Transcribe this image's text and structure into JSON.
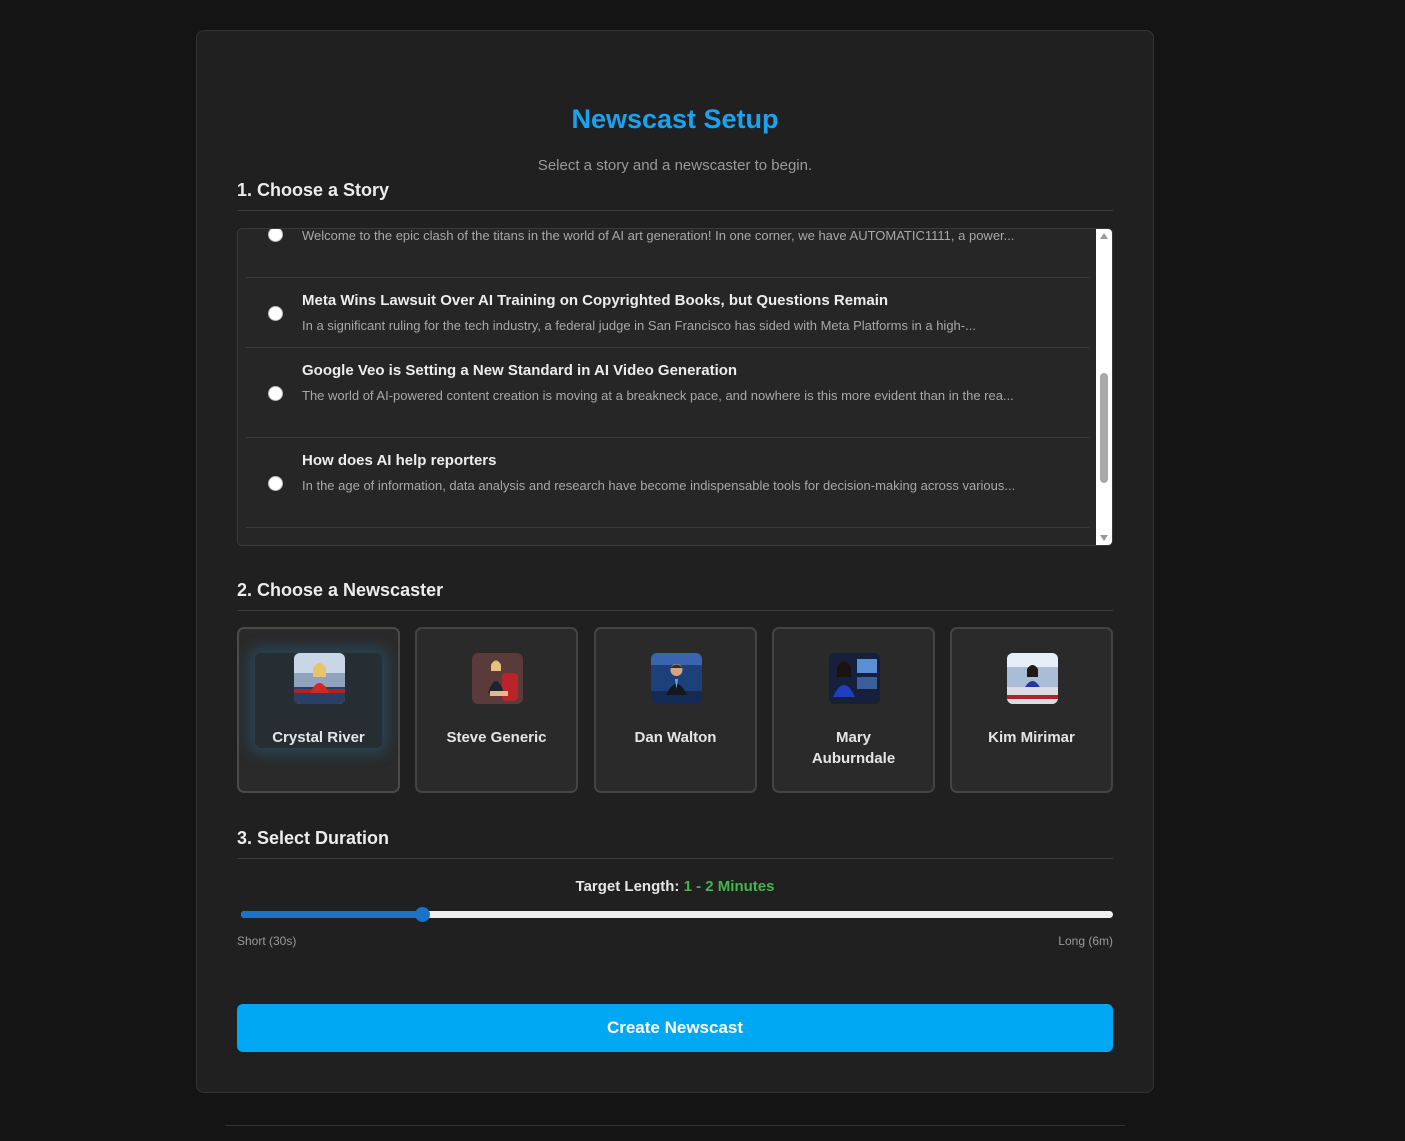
{
  "header": {
    "title": "Newscast Setup",
    "subtitle": "Select a story and a newscaster to begin."
  },
  "sections": {
    "story": "1. Choose a Story",
    "newscaster": "2. Choose a Newscaster",
    "duration": "3. Select Duration"
  },
  "stories": [
    {
      "title": "",
      "snippet": "Welcome to the epic clash of the titans in the world of AI art generation! In one corner, we have AUTOMATIC1111, a power...",
      "selected": false
    },
    {
      "title": "Meta Wins Lawsuit Over AI Training on Copyrighted Books, but Questions Remain",
      "snippet": "In a significant ruling for the tech industry, a federal judge in San Francisco has sided with Meta Platforms in a high-...",
      "selected": false
    },
    {
      "title": "Google Veo is Setting a New Standard in AI Video Generation",
      "snippet": "The world of AI-powered content creation is moving at a breakneck pace, and nowhere is this more evident than in the rea...",
      "selected": false
    },
    {
      "title": "How does AI help reporters",
      "snippet": "In the age of information, data analysis and research have become indispensable tools for decision-making across various...",
      "selected": false
    }
  ],
  "newscasters": [
    {
      "name": "Crystal River",
      "selected": true,
      "avatar_icon": "anchor-woman-red-icon"
    },
    {
      "name": "Steve Generic",
      "selected": false,
      "avatar_icon": "anchor-woman-seated-icon"
    },
    {
      "name": "Dan Walton",
      "selected": false,
      "avatar_icon": "anchor-man-icon"
    },
    {
      "name": "Mary Auburndale",
      "selected": false,
      "avatar_icon": "anchor-woman-blue-icon"
    },
    {
      "name": "Kim Mirimar",
      "selected": false,
      "avatar_icon": "anchor-woman-desk-icon"
    }
  ],
  "duration": {
    "target_label": "Target Length:",
    "target_value": "1 - 2 Minutes",
    "min_label": "Short (30s)",
    "max_label": "Long (6m)",
    "slider_fraction": 0.207
  },
  "actions": {
    "create_label": "Create Newscast"
  },
  "colors": {
    "accent": "#1aa3f0",
    "button": "#00a8f3",
    "duration_value": "#43b649",
    "slider": "#1a73c8"
  }
}
